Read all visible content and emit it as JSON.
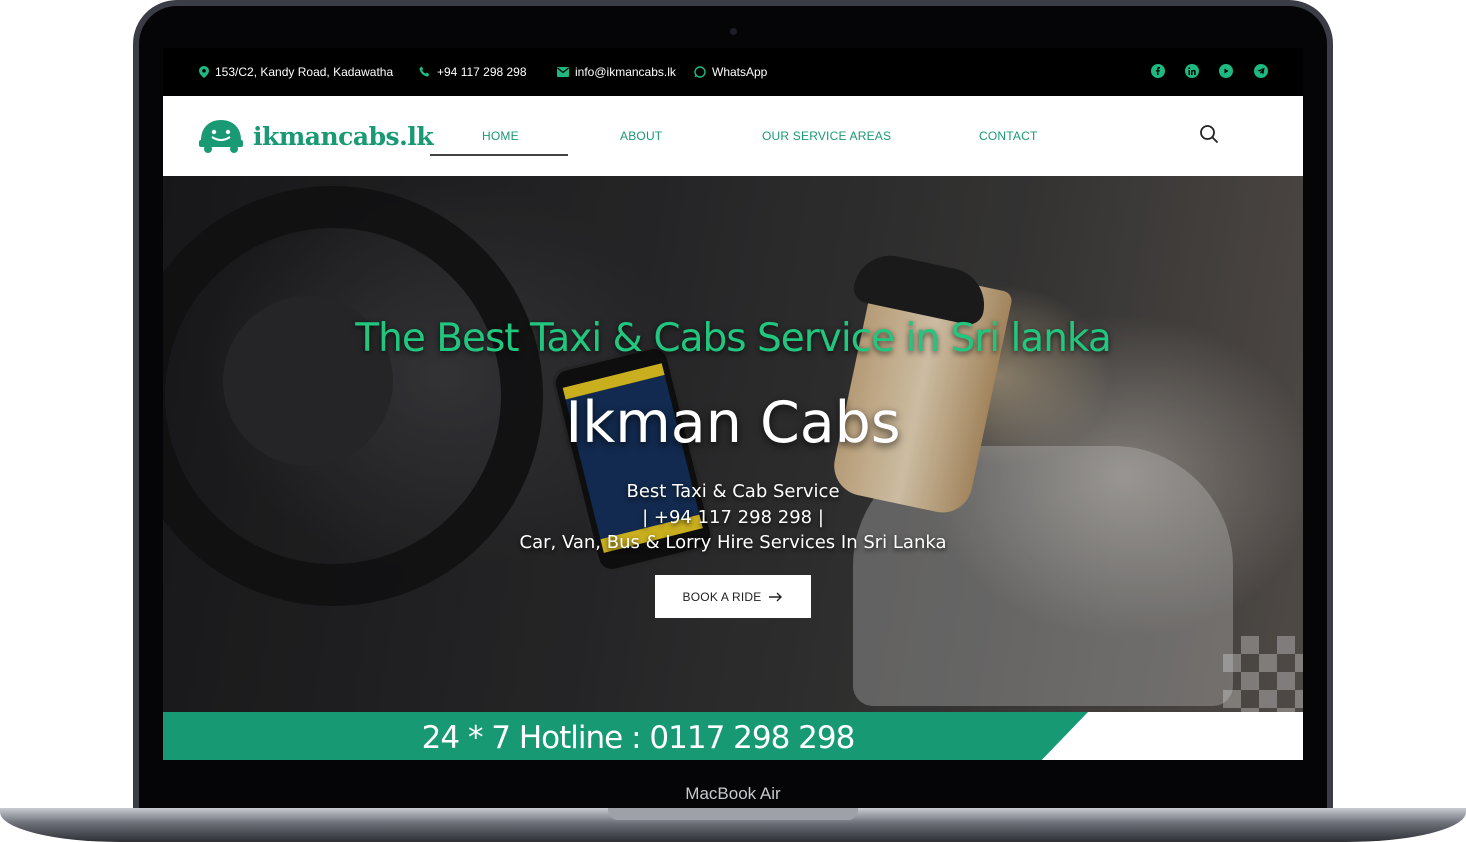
{
  "device": {
    "label": "MacBook Air"
  },
  "topbar": {
    "address": "153/C2, Kandy Road, Kadawatha",
    "phone": "+94 117 298 298",
    "email": "info@ikmancabs.lk",
    "whatsapp": "WhatsApp",
    "social_icons": [
      "facebook-icon",
      "linkedin-icon",
      "youtube-icon",
      "telegram-icon"
    ]
  },
  "brand": {
    "name": "ikmancabs.lk",
    "color": "#199a74"
  },
  "nav": {
    "items": [
      {
        "label": "HOME",
        "active": true
      },
      {
        "label": "ABOUT",
        "active": false
      },
      {
        "label": "OUR SERVICE AREAS",
        "active": false
      },
      {
        "label": "CONTACT",
        "active": false
      }
    ]
  },
  "hero": {
    "tagline": "The Best Taxi & Cabs Service in Sri lanka",
    "title": "Ikman Cabs",
    "line1": "Best Taxi & Cab Service",
    "line2": "| +94 117 298 298 |",
    "line3": "Car, Van, Bus & Lorry Hire Services In Sri Lanka",
    "cta_label": "BOOK A RIDE",
    "tagline_color": "#21c67f"
  },
  "hotline": {
    "text": "24 * 7 Hotline : 0117 298 298",
    "color": "#179a74"
  }
}
